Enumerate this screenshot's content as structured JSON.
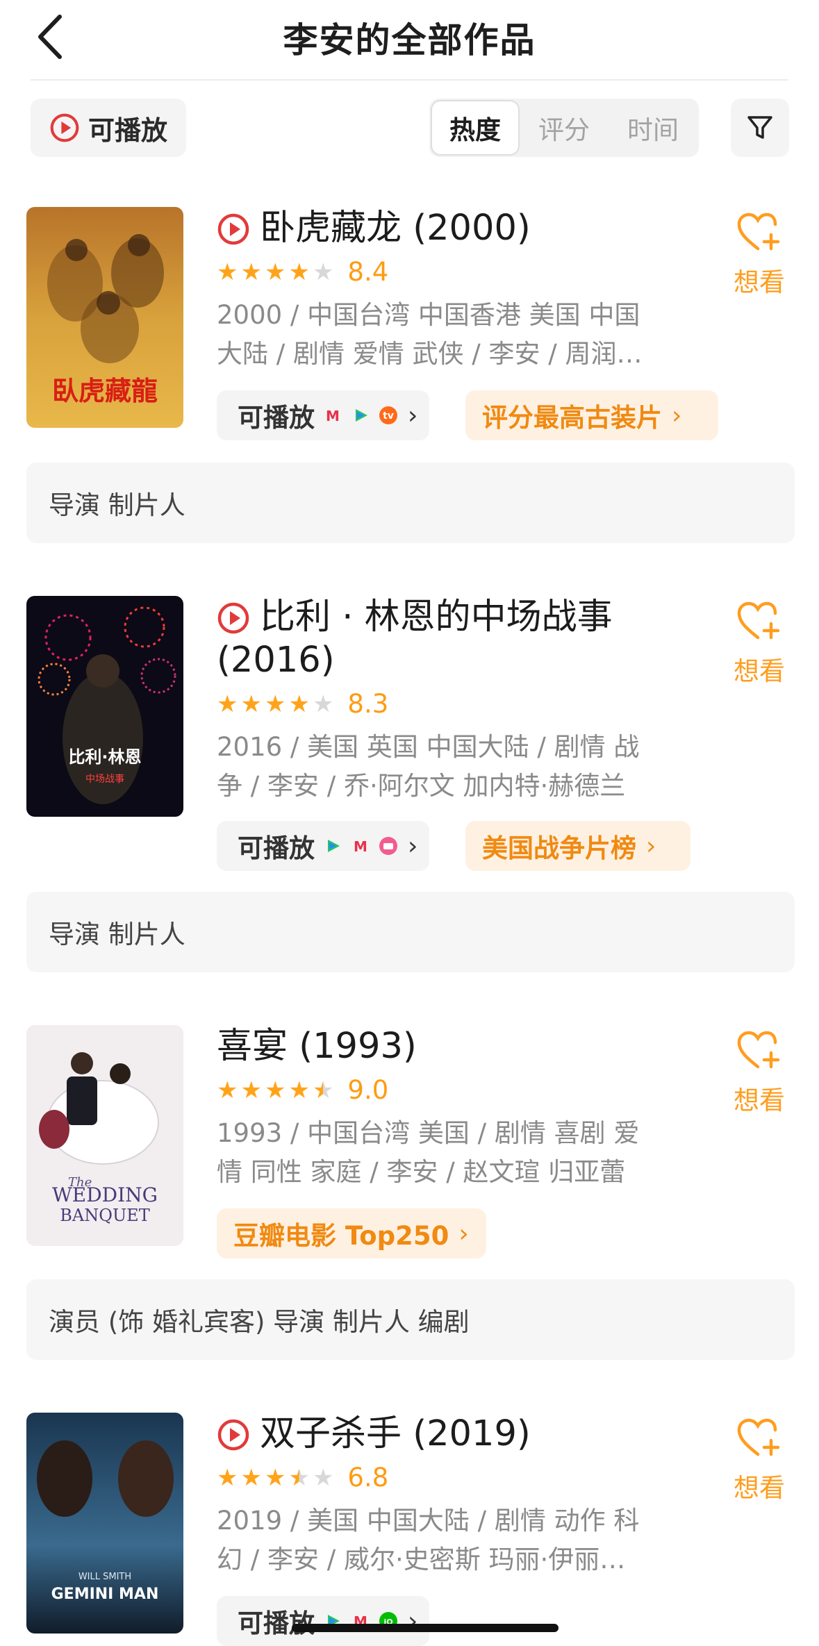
{
  "header": {
    "title": "李安的全部作品"
  },
  "toolbar": {
    "playable_label": "可播放",
    "sort_tabs": [
      {
        "label": "热度",
        "active": true
      },
      {
        "label": "评分",
        "active": false
      },
      {
        "label": "时间",
        "active": false
      }
    ]
  },
  "colors": {
    "accent": "#ff9b10",
    "play_red": "#e23a3a",
    "star": "#ffa41a"
  },
  "movies": [
    {
      "title": "卧虎藏龙 (2000)",
      "playable": true,
      "stars": 4,
      "score": "8.4",
      "meta": "2000 / 中国台湾 中国香港 美国 中国大陆 / 剧情 爱情 武侠 / 李安 / 周润…",
      "playable_pill": "可播放",
      "ranking_pill": "评分最高古装片",
      "wish_label": "想看",
      "roles": "导演 制片人",
      "poster_title": "臥虎藏龍"
    },
    {
      "title": "比利 · 林恩的中场战事 (2016)",
      "title_line1": "比利 · 林恩的中场战事",
      "title_line2": "(2016)",
      "playable": true,
      "stars": 4,
      "score": "8.3",
      "meta": "2016 / 美国 英国 中国大陆 / 剧情 战争 / 李安 / 乔·阿尔文 加内特·赫德兰",
      "playable_pill": "可播放",
      "ranking_pill": "美国战争片榜",
      "wish_label": "想看",
      "roles": "导演 制片人",
      "poster_title": "比利·林恩",
      "poster_sub": "中场战事"
    },
    {
      "title": "喜宴 (1993)",
      "playable": false,
      "stars": 4.5,
      "score": "9.0",
      "meta": "1993 / 中国台湾 美国 / 剧情 喜剧 爱情 同性 家庭 / 李安 / 赵文瑄 归亚蕾",
      "ranking_pill": "豆瓣电影 Top250",
      "wish_label": "想看",
      "roles": "演员 (饰 婚礼宾客) 导演 制片人 编剧",
      "poster_title": "WEDDING",
      "poster_sub": "BANQUET",
      "poster_the": "The"
    },
    {
      "title": "双子杀手 (2019)",
      "playable": true,
      "stars": 3.5,
      "score": "6.8",
      "meta": "2019 / 美国 中国大陆 / 剧情 动作 科幻 / 李安 / 威尔·史密斯 玛丽·伊丽…",
      "playable_pill": "可播放",
      "wish_label": "想看",
      "poster_title": "GEMINI MAN",
      "poster_actor": "WILL SMITH"
    }
  ]
}
